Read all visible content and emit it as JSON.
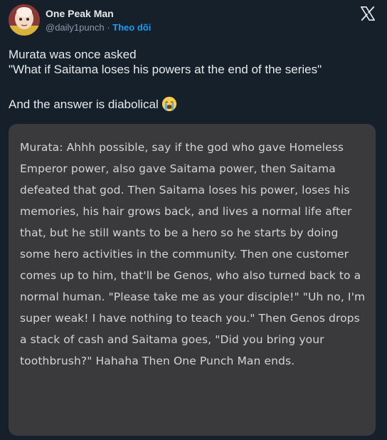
{
  "author": {
    "display_name": "One Peak Man",
    "handle": "@daily1punch",
    "separator": " · ",
    "follow_label": "Theo dõi",
    "avatar_icon": "avatar-saitama"
  },
  "brand_icon": "x-logo-icon",
  "tweet": {
    "line1": "Murata was once asked",
    "line2": "\"What if Saitama loses his powers at the end of the series\"",
    "line3": "And the answer is diabolical",
    "emoji": "loudly-crying-face-icon"
  },
  "media": {
    "quote": "Murata: Ahhh possible, say if the god who gave Homeless Emperor power, also gave Saitama power, then Saitama defeated that god. Then Saitama loses his power, loses his memories, his hair grows back, and lives a normal life after that, but he still wants to be a hero so he starts by doing some hero activities in the community. Then one customer comes up to him, that'll be Genos, who also turned back to a normal human. \"Please take me as your disciple!\" \"Uh no, I'm super weak! I have nothing to teach you.\" Then Genos drops a stack of cash and Saitama goes, \"Did you bring your toothbrush?\" Hahaha Then One Punch Man ends."
  },
  "colors": {
    "background": "#15202b",
    "text": "#e7e9ea",
    "muted": "#8b98a5",
    "accent": "#1d9bf0",
    "media_bg": "#3a3a3c"
  }
}
